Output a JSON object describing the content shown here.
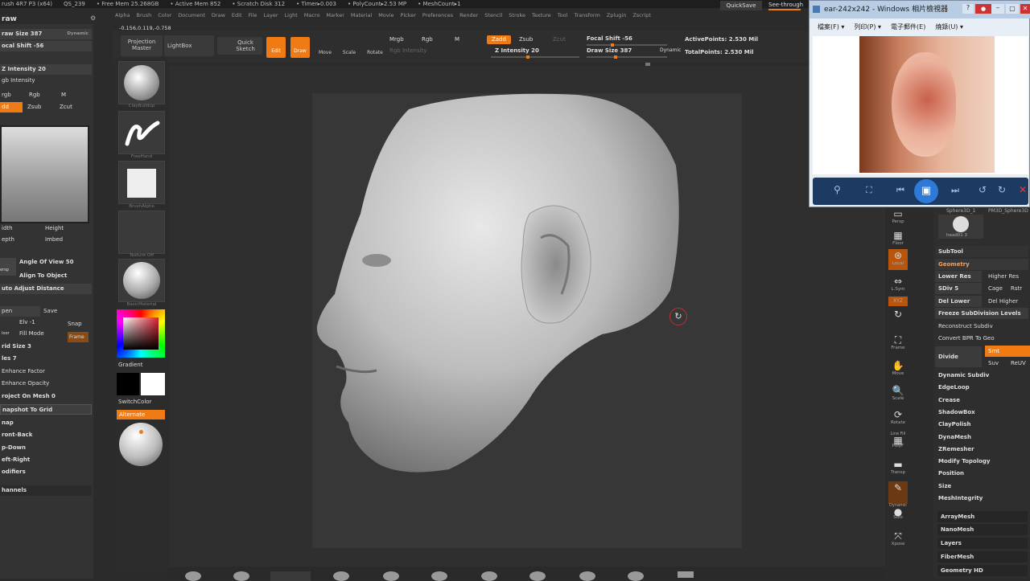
{
  "titlebar": {
    "items": [
      "rush 4R7 P3 (x64)",
      "QS_239",
      "• Free Mem 25.268GB",
      "• Active Mem 852",
      "• Scratch Disk 312",
      "• Timer▸0.003",
      "• PolyCount▸2.53 MP",
      "• MeshCount▸1"
    ]
  },
  "quicksave": "QuickSave",
  "seethrough": "See-through",
  "menu": [
    "Alpha",
    "Brush",
    "Color",
    "Document",
    "Draw",
    "Edit",
    "File",
    "Layer",
    "Light",
    "Macro",
    "Marker",
    "Material",
    "Movie",
    "Picker",
    "Preferences",
    "Render",
    "Stencil",
    "Stroke",
    "Texture",
    "Tool",
    "Transform",
    "Zplugin",
    "Zscript"
  ],
  "coords": "-0.156,0.119,-0.758",
  "toolbar": {
    "projection_master": "Projection Master",
    "lightbox": "LightBox",
    "quick_sketch": "Quick Sketch",
    "edit": "Edit",
    "draw": "Draw",
    "move": "Move",
    "scale": "Scale",
    "rotate": "Rotate",
    "mrgb": "Mrgb",
    "rgb": "Rgb",
    "m": "M",
    "rgb_intensity": "Rgb Intensity",
    "zadd": "Zadd",
    "zsub": "Zsub",
    "zcut": "Zcut",
    "z_intensity": "Z Intensity 20",
    "focal_shift": "Focal Shift -56",
    "draw_size": "Draw Size 387",
    "dynamic": "Dynamic",
    "active_points": "ActivePoints: 2.530 Mil",
    "total_points": "TotalPoints: 2.530 Mil"
  },
  "left": {
    "title": "raw",
    "draw_size": "raw Size 387",
    "dynamic": "Dynamic",
    "focal_shift": "ocal Shift -56",
    "z_intensity": "Z Intensity 20",
    "rgb_intensity": "gb Intensity",
    "mrgb": "rgb",
    "rgb": "Rgb",
    "m": "M",
    "zadd": "dd",
    "zsub": "Zsub",
    "zcut": "Zcut",
    "width": "idth",
    "height": "Height",
    "depth": "epth",
    "imbed": "Imbed",
    "persp": "ersp",
    "angle_of_view": "Angle Of View 50",
    "align_to_object": "Align To Object",
    "auto_adjust": "uto Adjust Distance",
    "open": "pen",
    "save": "Save",
    "elv": "Elv -1",
    "snap": "Snap",
    "floor": "loor",
    "fill_mode": "Fill Mode",
    "frame": "Frame",
    "grid_size": "rid Size 3",
    "tiles": "les 7",
    "enhance_factor": "Enhance Factor",
    "enhance_opacity": "Enhance Opacity",
    "project_on_mesh": "roject On Mesh 0",
    "snapshot_to_grid": "napshot To Grid",
    "snap2": "nap",
    "front_back": "ront-Back",
    "up_down": "p-Down",
    "left_right": "eft-Right",
    "modifiers": "odifiers",
    "channels": "hannels"
  },
  "shelf": {
    "brush": "ClayBuildup",
    "stroke": "FreeHand",
    "alpha": "BrushAlpha",
    "texture": "Texture Off",
    "material": "BasicMaterial",
    "gradient": "Gradient",
    "switch_color": "SwitchColor",
    "alternate": "Alternate"
  },
  "right_shelf": {
    "persp": "Persp",
    "floor": "Floor",
    "local": "Local",
    "lsym": "L.Sym",
    "xyz": "XYZ",
    "frame": "Frame",
    "move": "Move",
    "scale": "Scale",
    "rotate": "Rotate",
    "line_fill": "Line Fill",
    "polyf": "PolyF",
    "transp": "Transp",
    "dynamic": "Dynamic",
    "solo": "Solo",
    "xpose": "Xpose"
  },
  "tool_panel": {
    "sphere3d": "Sphere3D_1",
    "pm3d": "PM3D_Sphere3D",
    "head": "head01 3",
    "subtool": "SubTool",
    "geometry": "Geometry",
    "lower_res": "Lower Res",
    "higher_res": "Higher Res",
    "sdiv": "SDiv 5",
    "cage": "Cage",
    "rstr": "Rstr",
    "del_lower": "Del Lower",
    "del_higher": "Del Higher",
    "freeze": "Freeze SubDivision Levels",
    "reconstruct": "Reconstruct Subdiv",
    "convert_bpr": "Convert BPR To Geo",
    "divide": "Divide",
    "smt": "Smt",
    "suv": "Suv",
    "reuv": "ReUV",
    "dynamic_subdiv": "Dynamic Subdiv",
    "edgeloop": "EdgeLoop",
    "crease": "Crease",
    "shadowbox": "ShadowBox",
    "claypolish": "ClayPolish",
    "dynamesh": "DynaMesh",
    "zremesher": "ZRemesher",
    "modify_topology": "Modify Topology",
    "position": "Position",
    "size": "Size",
    "meshintegrity": "MeshIntegrity",
    "arraymesh": "ArrayMesh",
    "nanomesh": "NanoMesh",
    "layers": "Layers",
    "fibermesh": "FiberMesh",
    "geometry_hd": "Geometry HD"
  },
  "viewer": {
    "title": "ear-242x242 - Windows 相片檢視器",
    "menu": [
      "檔案(F) ▾",
      "列印(P) ▾",
      "電子郵件(E)",
      "燒錄(U) ▾"
    ]
  },
  "colors": {
    "accent": "#f07a14",
    "panel": "#333333",
    "canvas": "#373737"
  }
}
